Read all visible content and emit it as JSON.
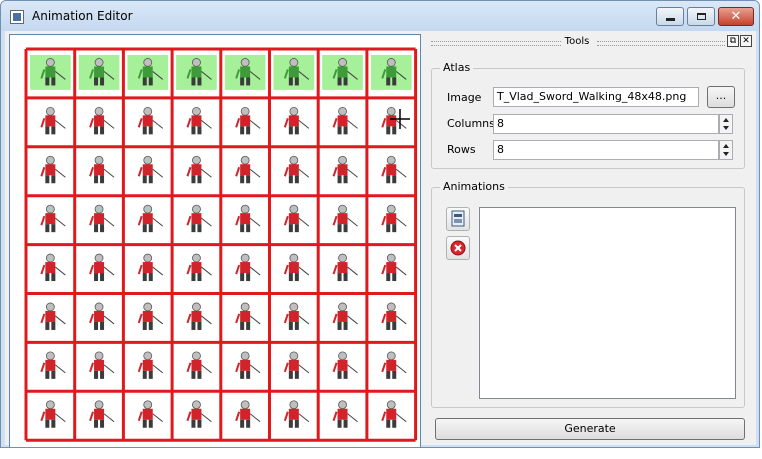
{
  "window": {
    "title": "Animation Editor",
    "close_glyph": "✕"
  },
  "canvas": {
    "grid_columns": 8,
    "grid_rows": 8,
    "highlighted_row": 1,
    "grid_color": "#e0191c",
    "highlight_color": "#a7f09a",
    "sprite_colors": {
      "tunic": "#d0242a",
      "dark": "#3b3b3b",
      "skin": "#bfbfbf"
    }
  },
  "tools_dock": {
    "title": "Tools",
    "float_glyph": "⧉",
    "close_glyph": "✕",
    "atlas": {
      "title": "Atlas",
      "image_label": "Image",
      "image_value": "T_Vlad_Sword_Walking_48x48.png",
      "browse_label": "...",
      "columns_label": "Columns",
      "columns_value": "8",
      "rows_label": "Rows",
      "rows_value": "8"
    },
    "animations": {
      "title": "Animations",
      "add_icon": "add-animation-icon",
      "remove_icon": "remove-animation-icon"
    },
    "generate_label": "Generate"
  }
}
